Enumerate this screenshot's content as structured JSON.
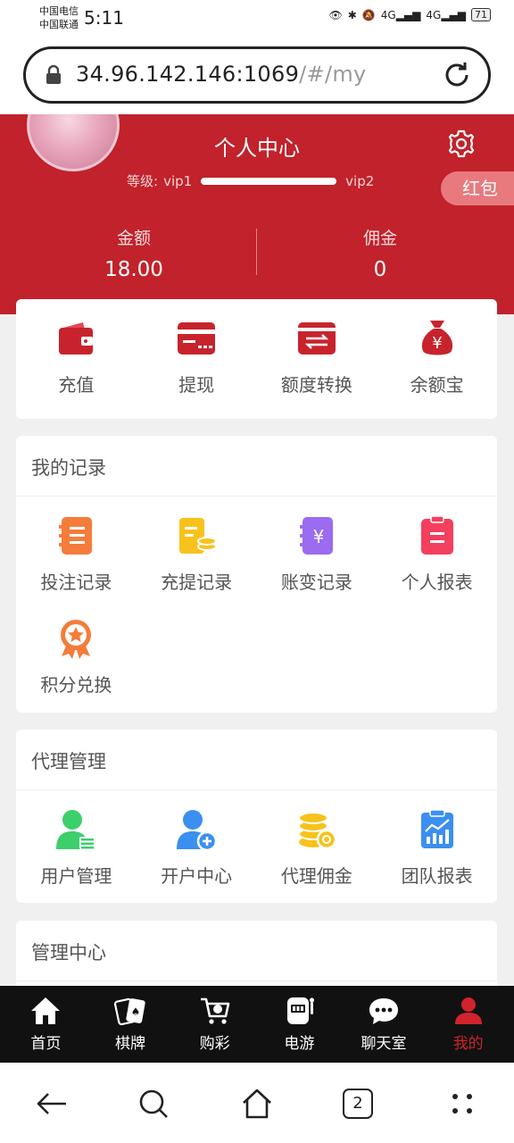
{
  "status": {
    "carrier1": "中国电信",
    "carrier2": "中国联通",
    "time": "5:11",
    "net1": "4G",
    "net2": "4G",
    "battery": "71"
  },
  "browser": {
    "url_main": "34.96.142.146:1069",
    "url_hash": "/#/my"
  },
  "header": {
    "title": "个人中心",
    "level_label": "等级:",
    "level_current": "vip1",
    "level_next": "vip2",
    "level_progress": 1.0,
    "hongbao": "红包",
    "balance_label": "金额",
    "balance_value": "18.00",
    "commission_label": "佣金",
    "commission_value": "0"
  },
  "quick_actions": [
    {
      "label": "充值",
      "icon": "wallet-icon"
    },
    {
      "label": "提现",
      "icon": "card-icon"
    },
    {
      "label": "额度转换",
      "icon": "transfer-icon"
    },
    {
      "label": "余额宝",
      "icon": "money-bag-icon"
    }
  ],
  "records": {
    "title": "我的记录",
    "items": [
      {
        "label": "投注记录",
        "icon": "notebook-icon"
      },
      {
        "label": "充提记录",
        "icon": "clipboard-coins-icon"
      },
      {
        "label": "账变记录",
        "icon": "yen-book-icon"
      },
      {
        "label": "个人报表",
        "icon": "report-icon"
      },
      {
        "label": "积分兑换",
        "icon": "medal-icon"
      }
    ]
  },
  "agent": {
    "title": "代理管理",
    "items": [
      {
        "label": "用户管理",
        "icon": "user-manage-icon"
      },
      {
        "label": "开户中心",
        "icon": "user-add-icon"
      },
      {
        "label": "代理佣金",
        "icon": "coins-icon"
      },
      {
        "label": "团队报表",
        "icon": "chart-clipboard-icon"
      }
    ]
  },
  "admin": {
    "title": "管理中心"
  },
  "tabs": [
    {
      "label": "首页",
      "icon": "home-icon"
    },
    {
      "label": "棋牌",
      "icon": "cards-icon"
    },
    {
      "label": "购彩",
      "icon": "cart-icon"
    },
    {
      "label": "电游",
      "icon": "slot-machine-icon"
    },
    {
      "label": "聊天室",
      "icon": "chat-icon"
    },
    {
      "label": "我的",
      "icon": "profile-icon",
      "active": true
    }
  ],
  "sysnav": {
    "tab_count": "2"
  },
  "colors": {
    "brand_red": "#c1222b",
    "tab_active": "#d0232d",
    "orange": "#f57c3a",
    "yellow": "#f8c21c",
    "purple": "#9b6bf0",
    "pink": "#f43f5e",
    "green": "#3ccf6b",
    "blue": "#3b8ff0"
  }
}
